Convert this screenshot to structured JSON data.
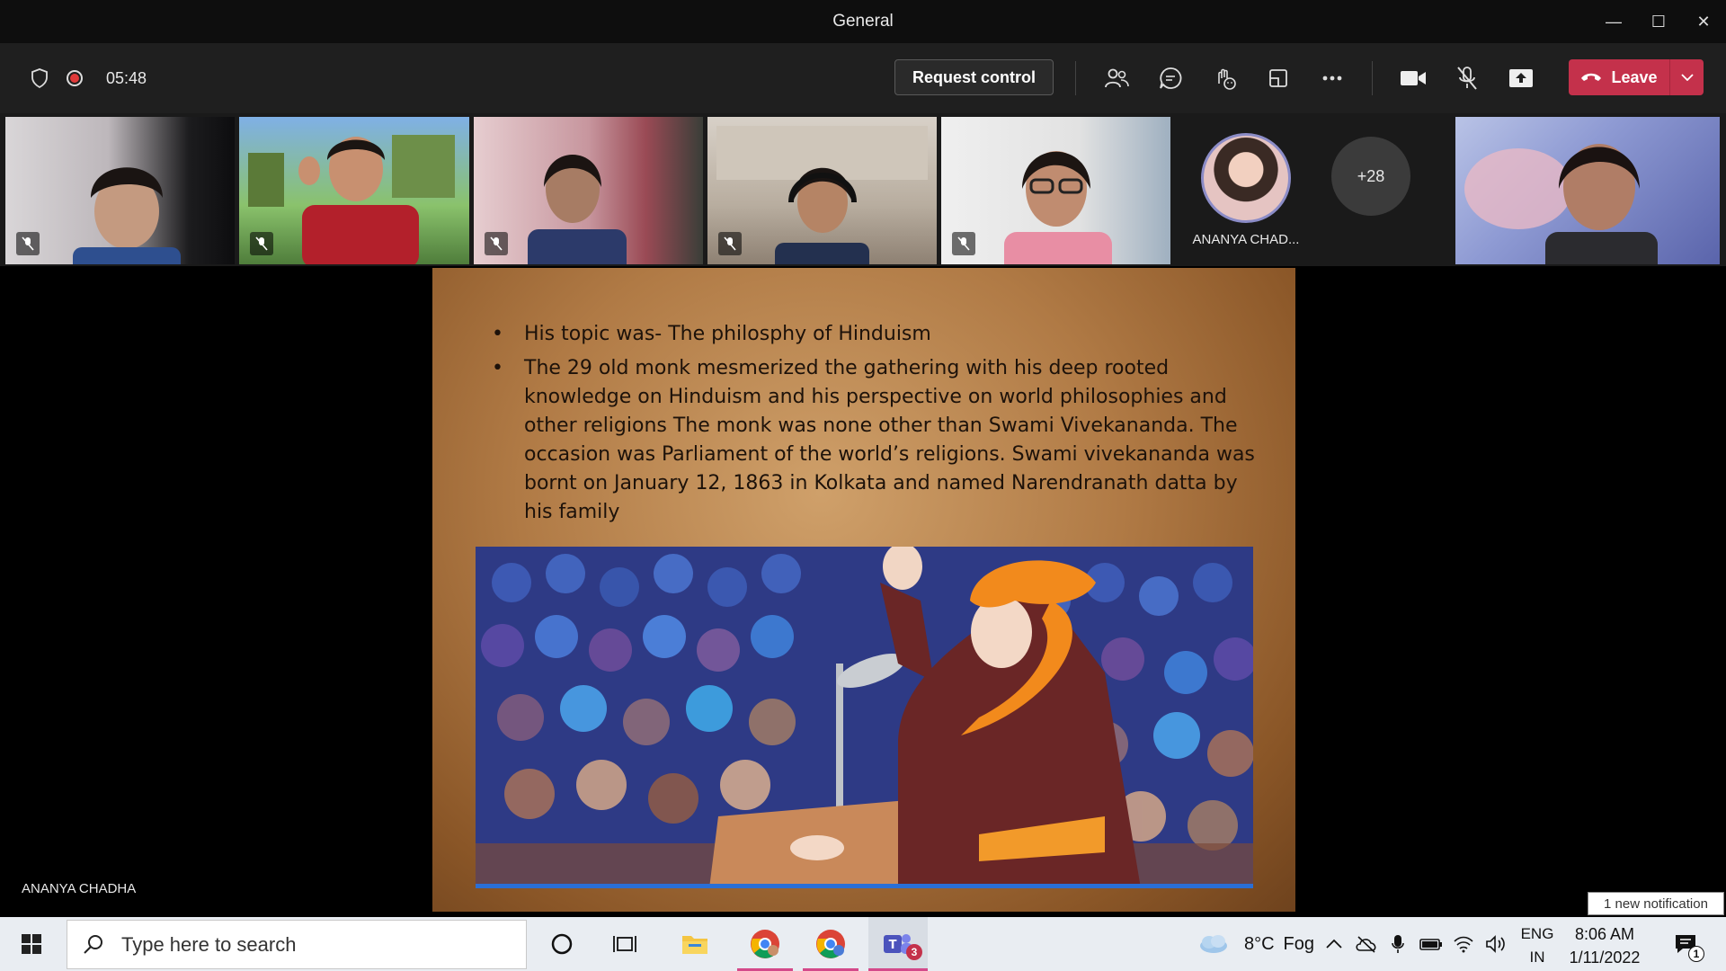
{
  "window": {
    "title": "General",
    "minimize_glyph": "—",
    "maximize_glyph": "☐",
    "close_glyph": "✕"
  },
  "toolbar": {
    "meeting_timer": "05:48",
    "request_control_label": "Request control",
    "leave_label": "Leave",
    "icons": [
      "participants-icon",
      "chat-icon",
      "reactions-icon",
      "rooms-icon",
      "more-options-icon",
      "camera-icon",
      "mic-muted-icon",
      "share-tray-icon"
    ]
  },
  "participants": {
    "avatar_name": "ANANYA CHAD...",
    "overflow_count": "+28",
    "tile_count": 6
  },
  "slide": {
    "bullets": [
      "His topic was- The philosphy of Hinduism",
      "The 29 old monk mesmerized  the gathering with his deep rooted knowledge on Hinduism and his perspective on world philosophies and other religions The monk was none other than Swami Vivekananda. The occasion was Parliament  of the world’s religions. Swami vivekananda  was bornt on January 12, 1863 in Kolkata and named Narendranath datta by his family"
    ]
  },
  "presenter": {
    "name": "ANANYA CHADHA"
  },
  "notification": {
    "text": "1 new notification"
  },
  "taskbar": {
    "search_placeholder": "Type here to search",
    "weather_temp": "8°C",
    "weather_desc": "Fog",
    "language_top": "ENG",
    "language_bottom": "IN",
    "time": "8:06 AM",
    "date": "1/11/2022",
    "teams_badge": "3",
    "notification_badge": "1"
  }
}
